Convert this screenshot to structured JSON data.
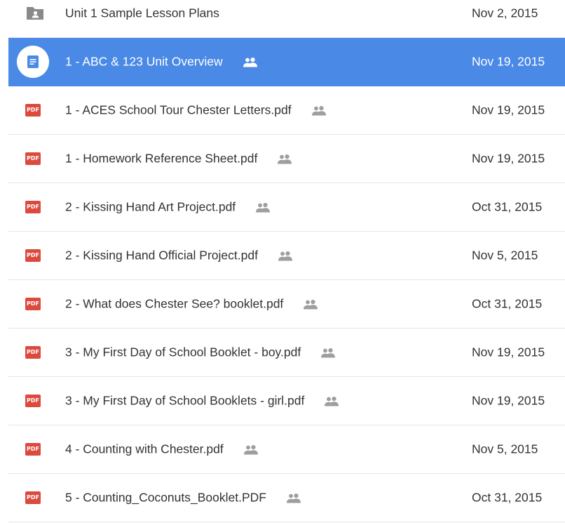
{
  "files": [
    {
      "name": "Unit 1 Sample Lesson Plans",
      "date": "Nov 2, 2015",
      "type": "folder",
      "icon": "shared-folder-icon",
      "shared": false,
      "selected": false
    },
    {
      "name": "1 - ABC & 123 Unit Overview",
      "date": "Nov 19, 2015",
      "type": "doc",
      "icon": "google-doc-icon",
      "shared": true,
      "selected": true
    },
    {
      "name": "1 - ACES School Tour Chester Letters.pdf",
      "date": "Nov 19, 2015",
      "type": "pdf",
      "icon": "pdf-icon",
      "shared": true,
      "selected": false
    },
    {
      "name": "1 - Homework Reference Sheet.pdf",
      "date": "Nov 19, 2015",
      "type": "pdf",
      "icon": "pdf-icon",
      "shared": true,
      "selected": false
    },
    {
      "name": "2 - Kissing Hand Art Project.pdf",
      "date": "Oct 31, 2015",
      "type": "pdf",
      "icon": "pdf-icon",
      "shared": true,
      "selected": false
    },
    {
      "name": "2 - Kissing Hand Official Project.pdf",
      "date": "Nov 5, 2015",
      "type": "pdf",
      "icon": "pdf-icon",
      "shared": true,
      "selected": false
    },
    {
      "name": "2 - What does Chester See? booklet.pdf",
      "date": "Oct 31, 2015",
      "type": "pdf",
      "icon": "pdf-icon",
      "shared": true,
      "selected": false
    },
    {
      "name": "3 - My First Day of School Booklet - boy.pdf",
      "date": "Nov 19, 2015",
      "type": "pdf",
      "icon": "pdf-icon",
      "shared": true,
      "selected": false
    },
    {
      "name": "3 - My First Day of School Booklets - girl.pdf",
      "date": "Nov 19, 2015",
      "type": "pdf",
      "icon": "pdf-icon",
      "shared": true,
      "selected": false
    },
    {
      "name": "4 - Counting with Chester.pdf",
      "date": "Nov 5, 2015",
      "type": "pdf",
      "icon": "pdf-icon",
      "shared": true,
      "selected": false
    },
    {
      "name": "5 - Counting_Coconuts_Booklet.PDF",
      "date": "Oct 31, 2015",
      "type": "pdf",
      "icon": "pdf-icon",
      "shared": true,
      "selected": false
    }
  ],
  "pdf_badge_text": "PDF",
  "colors": {
    "selection": "#4a89e6",
    "pdf": "#dc4a3e",
    "folder": "#8a8a8a",
    "shared_icon": "#9e9e9e",
    "text": "#333333"
  }
}
